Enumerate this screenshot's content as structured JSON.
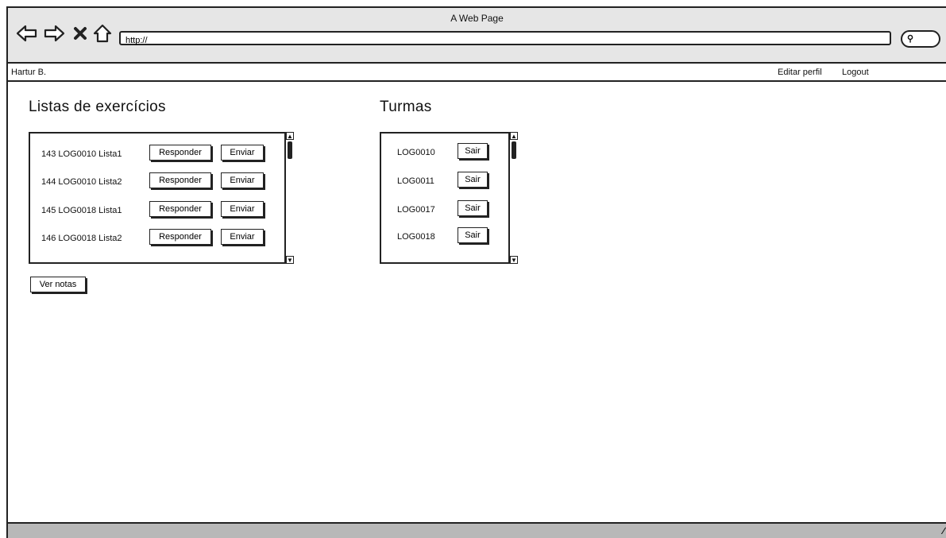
{
  "browser": {
    "window_title": "A Web Page",
    "url": "http://",
    "search_icon": "search-icon"
  },
  "menubar": {
    "user": "Hartur B.",
    "edit_profile": "Editar perfil",
    "logout": "Logout"
  },
  "listas": {
    "title": "Listas de exercícios",
    "items": [
      {
        "label": "143 LOG0010 Lista1",
        "answer": "Responder",
        "send": "Enviar"
      },
      {
        "label": "144 LOG0010 Lista2",
        "answer": "Responder",
        "send": "Enviar"
      },
      {
        "label": "145 LOG0018 Lista1",
        "answer": "Responder",
        "send": "Enviar"
      },
      {
        "label": "146 LOG0018 Lista2",
        "answer": "Responder",
        "send": "Enviar"
      }
    ],
    "grades_button": "Ver notas"
  },
  "turmas": {
    "title": "Turmas",
    "items": [
      {
        "label": "LOG0010",
        "leave": "Sair"
      },
      {
        "label": "LOG0011",
        "leave": "Sair"
      },
      {
        "label": "LOG0017",
        "leave": "Sair"
      },
      {
        "label": "LOG0018",
        "leave": "Sair"
      }
    ]
  }
}
